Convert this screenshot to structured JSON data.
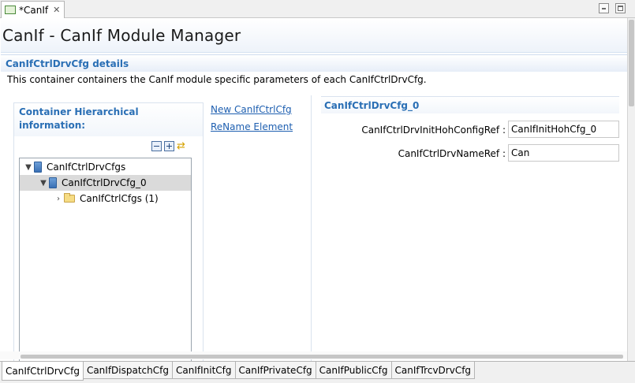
{
  "editor_tab": {
    "label": "*CanIf",
    "close_glyph": "✕"
  },
  "page_title": "CanIf - CanIf Module Manager",
  "section": {
    "title": "CanIfCtrlDrvCfg details",
    "description": "This container containers the CanIf module specific parameters of each CanIfCtrlDrvCfg."
  },
  "left": {
    "hierarchy_label": "Container Hierarchical information:",
    "tools": [
      "collapse-all-icon",
      "expand-all-icon",
      "link-editor-icon"
    ],
    "tree": [
      {
        "label": "CanIfCtrlDrvCfgs",
        "expanded": true,
        "icon": "container-icon",
        "selected": false
      },
      {
        "label": "CanIfCtrlDrvCfg_0",
        "expanded": true,
        "icon": "container-icon",
        "selected": true
      },
      {
        "label": "CanIfCtrlCfgs (1)",
        "expanded": false,
        "icon": "folder-icon",
        "selected": false
      }
    ]
  },
  "actions": {
    "new_label": "New CanIfCtrlCfg",
    "rename_label": "ReName Element"
  },
  "right": {
    "title": "CanIfCtrlDrvCfg_0",
    "fields": [
      {
        "label": "CanIfCtrlDrvInitHohConfigRef :",
        "value": "CanIfInitHohCfg_0"
      },
      {
        "label": "CanIfCtrlDrvNameRef :",
        "value": "Can"
      }
    ]
  },
  "bottom_tabs": [
    {
      "label": "CanIfCtrlDrvCfg",
      "active": true
    },
    {
      "label": "CanIfDispatchCfg",
      "active": false
    },
    {
      "label": "CanIfInitCfg",
      "active": false
    },
    {
      "label": "CanIfPrivateCfg",
      "active": false
    },
    {
      "label": "CanIfPublicCfg",
      "active": false
    },
    {
      "label": "CanIfTrcvDrvCfg",
      "active": false
    }
  ],
  "colors": {
    "accent": "#2a6fb5",
    "link": "#1e5fb0",
    "selection": "#dadada"
  }
}
